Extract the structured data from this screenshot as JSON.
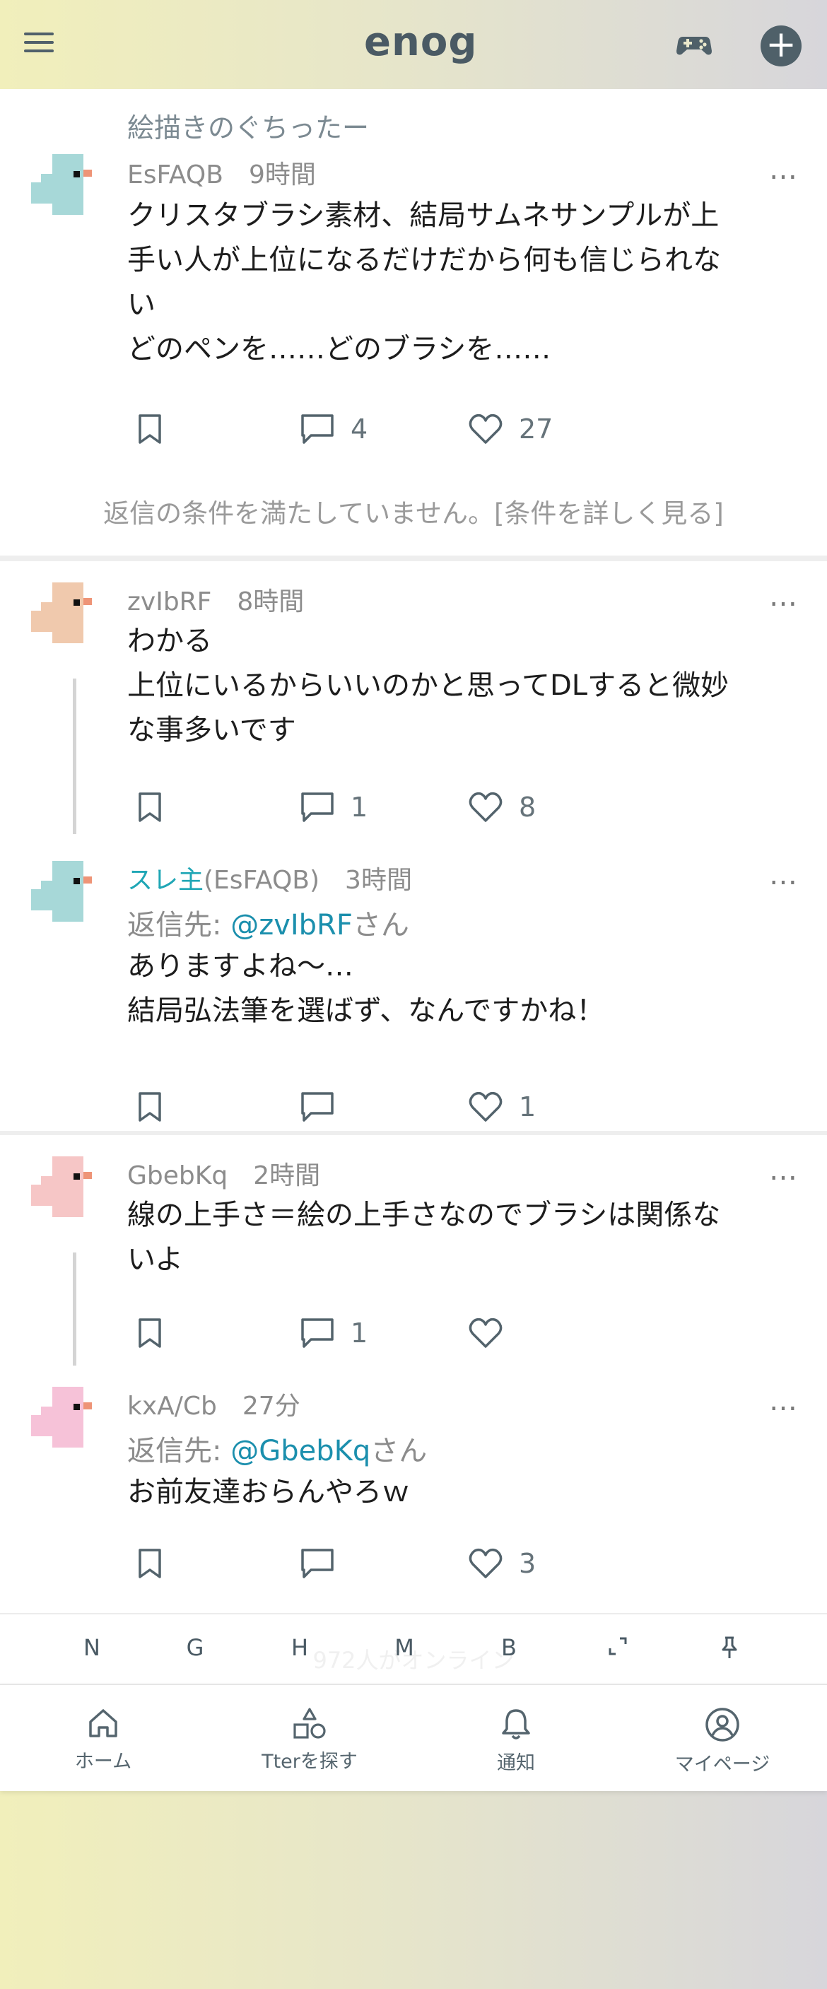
{
  "app": {
    "logo": "enog"
  },
  "topbar": {
    "menu_icon": "hamburger-menu-icon",
    "game_icon": "gamepad-icon",
    "add_icon": "plus-icon"
  },
  "community_name": "絵描きのぐちったー",
  "posts": [
    {
      "author": "EsFAQB",
      "time": "9時間",
      "lines": [
        "クリスタブラシ素材、結局サムネサンプルが上",
        "手い人が上位になるだけだから何も信じられな",
        "い",
        "どのペンを……どのブラシを……"
      ],
      "comments": "4",
      "likes": "27",
      "avatar_color": "#a7d8d8"
    },
    {
      "author": "zvIbRF",
      "time": "8時間",
      "lines": [
        "わかる",
        "上位にいるからいいのかと思ってDLすると微妙",
        "な事多いです"
      ],
      "comments": "1",
      "likes": "8",
      "avatar_color": "#f0c9ad"
    },
    {
      "op_label": "スレ主",
      "author": "(EsFAQB)",
      "time": "3時間",
      "reply_prefix": "返信先: ",
      "reply_to": "@zvIbRF",
      "reply_suffix": "さん",
      "lines": [
        "ありますよね〜…",
        "結局弘法筆を選ばず、なんですかね！"
      ],
      "comments": "",
      "likes": "1",
      "avatar_color": "#a7d8d8"
    },
    {
      "author": "GbebKq",
      "time": "2時間",
      "lines": [
        "線の上手さ＝絵の上手さなのでブラシは関係な",
        "いよ"
      ],
      "comments": "1",
      "likes": "",
      "avatar_color": "#f6c6c6"
    },
    {
      "author": "kxA/Cb",
      "time": "27分",
      "reply_prefix": "返信先: ",
      "reply_to": "@GbebKq",
      "reply_suffix": "さん",
      "lines": [
        "お前友達おらんやろｗ"
      ],
      "comments": "",
      "likes": "3",
      "avatar_color": "#f6c2d8"
    }
  ],
  "notice": {
    "text": "返信の条件を満たしていません。",
    "link": "[条件を詳しく見る]"
  },
  "more_label": "…",
  "keybar": {
    "keys": [
      "N",
      "G",
      "H",
      "M",
      "B"
    ],
    "expand_icon": "expand-icon",
    "pin_icon": "pin-icon",
    "online_text": "972人がオンライン"
  },
  "bottom_nav": [
    {
      "label": "ホーム",
      "icon": "home-icon"
    },
    {
      "label": "Tterを探す",
      "icon": "shapes-icon"
    },
    {
      "label": "通知",
      "icon": "bell-icon"
    },
    {
      "label": "マイページ",
      "icon": "user-circle-icon"
    }
  ],
  "colors": {
    "accent": "#1b8fad",
    "op_label": "#1fa6b5",
    "icon": "#50606a"
  }
}
